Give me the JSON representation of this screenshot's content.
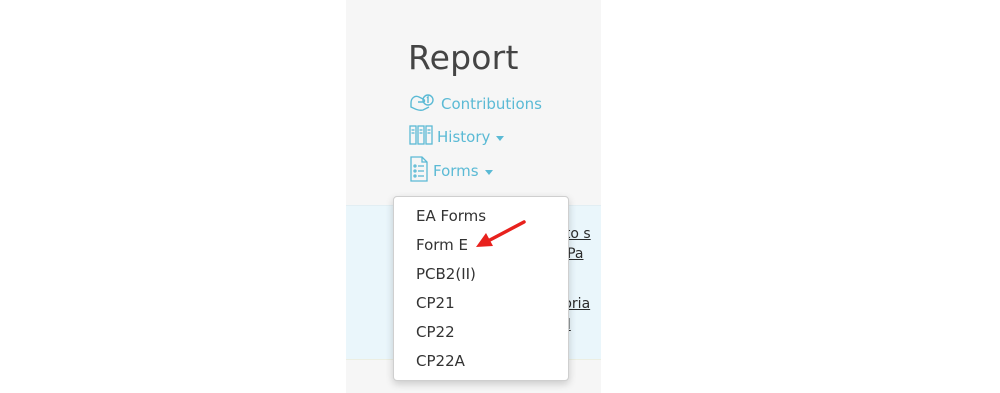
{
  "report": {
    "title": "Report",
    "nav": {
      "contributions": "Contributions",
      "history": "History",
      "forms": "Forms"
    }
  },
  "forms_dropdown": {
    "items": [
      "EA Forms",
      "Form E",
      "PCB2(II)",
      "CP21",
      "CP22",
      "CP22A"
    ]
  },
  "tips": {
    "link1_line1": "w to s",
    "link1_line2": "m Pa",
    "link2_line1": "utoria",
    "link2_line2": "roll"
  },
  "colors": {
    "accent": "#5bbad5",
    "arrow": "#e8211d"
  }
}
